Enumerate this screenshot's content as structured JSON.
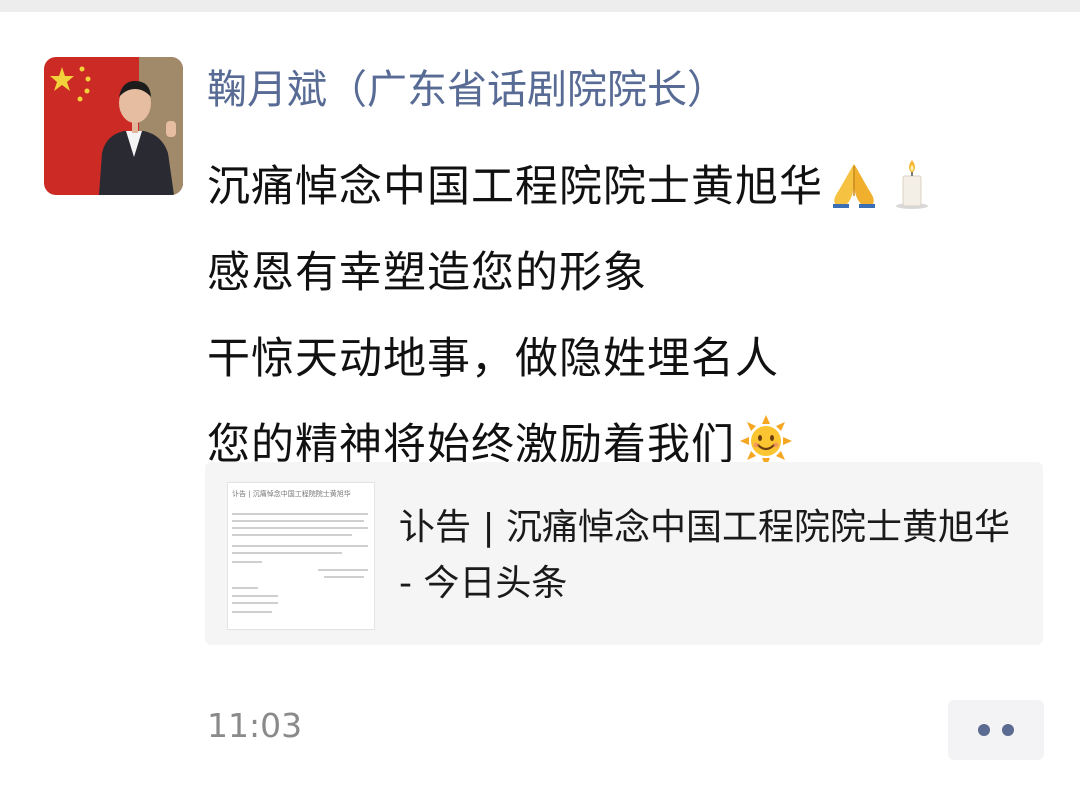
{
  "post": {
    "author": "鞠月斌（广东省话剧院院长）",
    "lines": [
      "沉痛悼念中国工程院院士黄旭华",
      "感恩有幸塑造您的形象",
      "干惊天动地事，做隐姓埋名人",
      "您的精神将始终激励着我们"
    ],
    "emojis": [
      "folded-hands-icon",
      "candle-icon",
      "sun-face-icon"
    ],
    "time": "11:03"
  },
  "link_card": {
    "title": "讣告 | 沉痛悼念中国工程院院士黄旭华 - 今日头条",
    "thumbnail_title": "讣告 | 沉痛悼念中国工程院院士黄旭华"
  },
  "colors": {
    "author_name": "#586b95",
    "body_text": "#111111",
    "link_card_bg": "#f5f5f5",
    "timestamp": "#8a8a8a",
    "more_dots": "#5a6a90"
  }
}
